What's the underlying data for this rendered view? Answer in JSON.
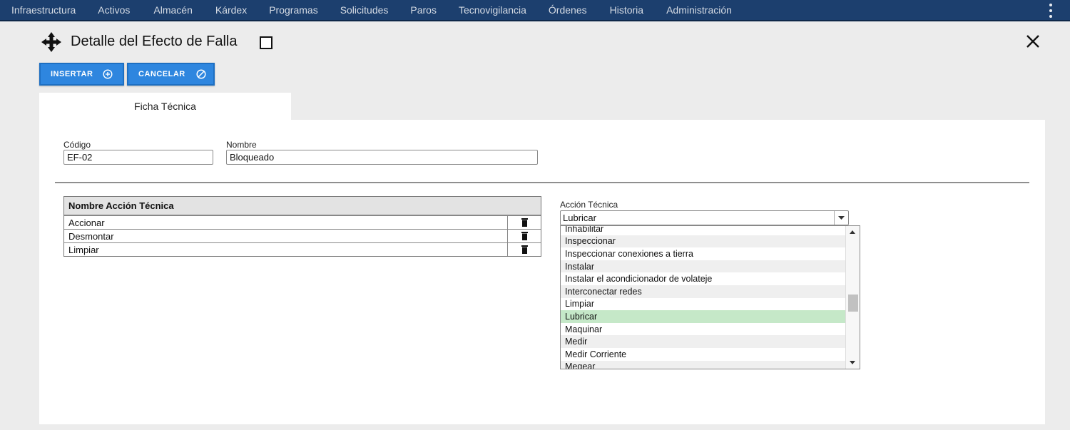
{
  "nav": {
    "items": [
      "Infraestructura",
      "Activos",
      "Almacén",
      "Kárdex",
      "Programas",
      "Solicitudes",
      "Paros",
      "Tecnovigilancia",
      "Órdenes",
      "Historia",
      "Administración"
    ]
  },
  "header": {
    "title": "Detalle del Efecto de Falla"
  },
  "toolbar": {
    "insert_label": "INSERTAR",
    "cancel_label": "CANCELAR"
  },
  "tabs": [
    "Ficha Técnica"
  ],
  "form": {
    "codigo_label": "Código",
    "codigo_value": "EF-02",
    "nombre_label": "Nombre",
    "nombre_value": "Bloqueado"
  },
  "grid": {
    "header": "Nombre Acción Técnica",
    "rows": [
      "Accionar",
      "Desmontar",
      "Limpiar"
    ]
  },
  "accion_tecnica": {
    "label": "Acción Técnica",
    "selected": "Lubricar",
    "options": [
      "Inhabilitar",
      "Inspeccionar",
      "Inspeccionar conexiones a tierra",
      "Instalar",
      "Instalar el acondicionador de volateje",
      "Interconectar redes",
      "Limpiar",
      "Lubricar",
      "Maquinar",
      "Medir",
      "Medir Corriente",
      "Megear"
    ]
  },
  "colors": {
    "nav_bg": "#1c3f6e",
    "button_bg": "#2e86df",
    "selected_option": "#c5e8c8"
  },
  "icons": {
    "move": "move-arrows-icon",
    "checkbox": "checkbox-icon",
    "close": "close-icon",
    "insert": "plus-circle-icon",
    "cancel": "cancel-circle-icon",
    "delete": "trash-icon",
    "menu": "kebab-menu-icon"
  }
}
